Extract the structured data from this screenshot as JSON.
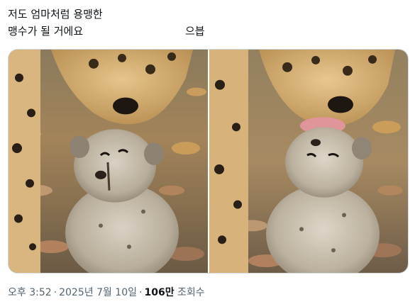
{
  "post": {
    "text_line1": "저도 엄마처럼 용맹한",
    "text_line2": "맹수가 될 거에요",
    "text_line2_tail": "으븝"
  },
  "media": {
    "left_photo_icon": "cheetah-kissing-cub-photo",
    "right_photo_icon": "cheetah-licking-cub-photo"
  },
  "meta": {
    "time": "오후 3:52",
    "separator": "·",
    "date": "2025년 7월 10일",
    "views_count": "106만",
    "views_label": "조회수"
  },
  "colors": {
    "text": "#0f1419",
    "secondary_text": "#536471",
    "border": "#cfd9de"
  }
}
